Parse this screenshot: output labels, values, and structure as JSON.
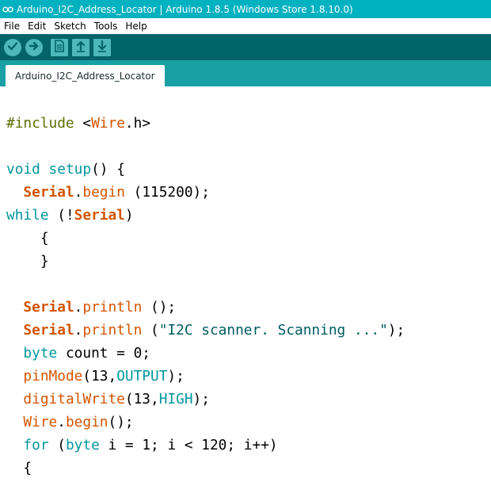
{
  "window": {
    "title": "Arduino_I2C_Address_Locator | Arduino 1.8.5 (Windows Store 1.8.10.0)",
    "app_icon": "arduino-infinity-icon"
  },
  "menu": [
    "File",
    "Edit",
    "Sketch",
    "Tools",
    "Help"
  ],
  "toolbar": [
    {
      "name": "verify",
      "icon": "checkmark-icon"
    },
    {
      "name": "upload",
      "icon": "arrow-right-icon"
    },
    {
      "name": "new",
      "icon": "document-icon"
    },
    {
      "name": "open",
      "icon": "arrow-up-icon"
    },
    {
      "name": "save",
      "icon": "arrow-down-icon"
    }
  ],
  "tabs": [
    {
      "label": "Arduino_I2C_Address_Locator",
      "active": true
    }
  ],
  "code_lines": [
    [
      {
        "t": "#include ",
        "c": "pre"
      },
      {
        "t": "<",
        "c": "plain"
      },
      {
        "t": "Wire",
        "c": "lib"
      },
      {
        "t": ".h>",
        "c": "plain"
      }
    ],
    [],
    [
      {
        "t": "void",
        "c": "kw"
      },
      {
        "t": " ",
        "c": "plain"
      },
      {
        "t": "setup",
        "c": "kw"
      },
      {
        "t": "() {",
        "c": "plain"
      }
    ],
    [
      {
        "t": "  ",
        "c": "plain"
      },
      {
        "t": "Serial",
        "c": "obj"
      },
      {
        "t": ".",
        "c": "plain"
      },
      {
        "t": "begin",
        "c": "fn"
      },
      {
        "t": " (115200);",
        "c": "plain"
      }
    ],
    [
      {
        "t": "while",
        "c": "kw"
      },
      {
        "t": " (!",
        "c": "plain"
      },
      {
        "t": "Serial",
        "c": "obj"
      },
      {
        "t": ")",
        "c": "plain"
      }
    ],
    [
      {
        "t": "    {",
        "c": "plain"
      }
    ],
    [
      {
        "t": "    }",
        "c": "plain"
      }
    ],
    [],
    [
      {
        "t": "  ",
        "c": "plain"
      },
      {
        "t": "Serial",
        "c": "obj"
      },
      {
        "t": ".",
        "c": "plain"
      },
      {
        "t": "println",
        "c": "fn"
      },
      {
        "t": " ();",
        "c": "plain"
      }
    ],
    [
      {
        "t": "  ",
        "c": "plain"
      },
      {
        "t": "Serial",
        "c": "obj"
      },
      {
        "t": ".",
        "c": "plain"
      },
      {
        "t": "println",
        "c": "fn"
      },
      {
        "t": " (",
        "c": "plain"
      },
      {
        "t": "\"I2C scanner. Scanning ...\"",
        "c": "str"
      },
      {
        "t": ");",
        "c": "plain"
      }
    ],
    [
      {
        "t": "  ",
        "c": "plain"
      },
      {
        "t": "byte",
        "c": "kw"
      },
      {
        "t": " count = 0;",
        "c": "plain"
      }
    ],
    [
      {
        "t": "  ",
        "c": "plain"
      },
      {
        "t": "pinMode",
        "c": "fn"
      },
      {
        "t": "(13,",
        "c": "plain"
      },
      {
        "t": "OUTPUT",
        "c": "kw"
      },
      {
        "t": ");",
        "c": "plain"
      }
    ],
    [
      {
        "t": "  ",
        "c": "plain"
      },
      {
        "t": "digitalWrite",
        "c": "fn"
      },
      {
        "t": "(13,",
        "c": "plain"
      },
      {
        "t": "HIGH",
        "c": "kw"
      },
      {
        "t": ");",
        "c": "plain"
      }
    ],
    [
      {
        "t": "  ",
        "c": "plain"
      },
      {
        "t": "Wire",
        "c": "lib"
      },
      {
        "t": ".",
        "c": "plain"
      },
      {
        "t": "begin",
        "c": "fn"
      },
      {
        "t": "();",
        "c": "plain"
      }
    ],
    [
      {
        "t": "  ",
        "c": "plain"
      },
      {
        "t": "for",
        "c": "kw"
      },
      {
        "t": " (",
        "c": "plain"
      },
      {
        "t": "byte",
        "c": "kw"
      },
      {
        "t": " i = 1; i < 120; i++)",
        "c": "plain"
      }
    ],
    [
      {
        "t": "  {",
        "c": "plain"
      }
    ]
  ],
  "colors": {
    "titlebar": "#00b1c0",
    "toolbar": "#006468",
    "tabstrip": "#17a1a5",
    "toolbar_button": "#4db7bb",
    "keyword": "#00979c",
    "function": "#d35400",
    "preprocessor": "#5e6d03",
    "string": "#005c5f"
  }
}
